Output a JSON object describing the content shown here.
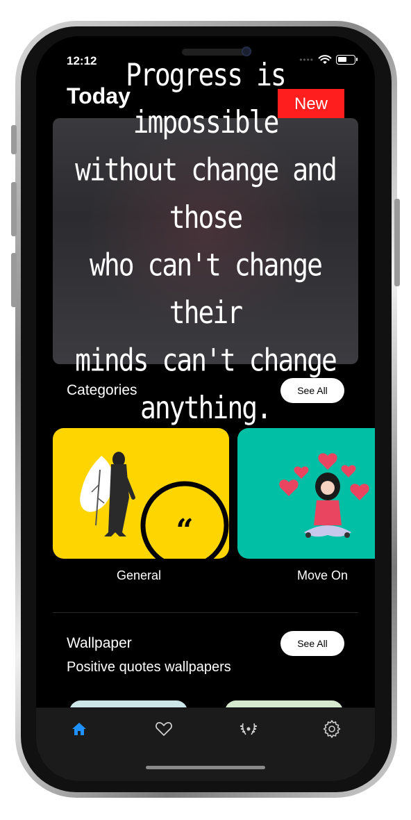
{
  "status_bar": {
    "time": "12:12"
  },
  "header": {
    "title": "Today",
    "badge": "New"
  },
  "quote": {
    "lines": [
      "Progress is impossible",
      "without change and those",
      "who can't change their",
      "minds can't change",
      "anything."
    ]
  },
  "categories": {
    "title": "Categories",
    "see_all": "See All",
    "items": [
      {
        "label": "General",
        "color": "#ffd500"
      },
      {
        "label": "Move On",
        "color": "#00bfa5"
      }
    ]
  },
  "wallpaper": {
    "title": "Wallpaper",
    "subtitle": "Positive quotes wallpapers",
    "see_all": "See All"
  },
  "tab_bar": {
    "items": [
      {
        "icon": "home-icon",
        "active": true
      },
      {
        "icon": "heart-icon",
        "active": false
      },
      {
        "icon": "laurel-icon",
        "active": false
      },
      {
        "icon": "gear-icon",
        "active": false
      }
    ],
    "active_color": "#1e90ff",
    "inactive_color": "#cfcfcf"
  },
  "colors": {
    "badge": "#ff1e1e",
    "background": "#000000"
  }
}
